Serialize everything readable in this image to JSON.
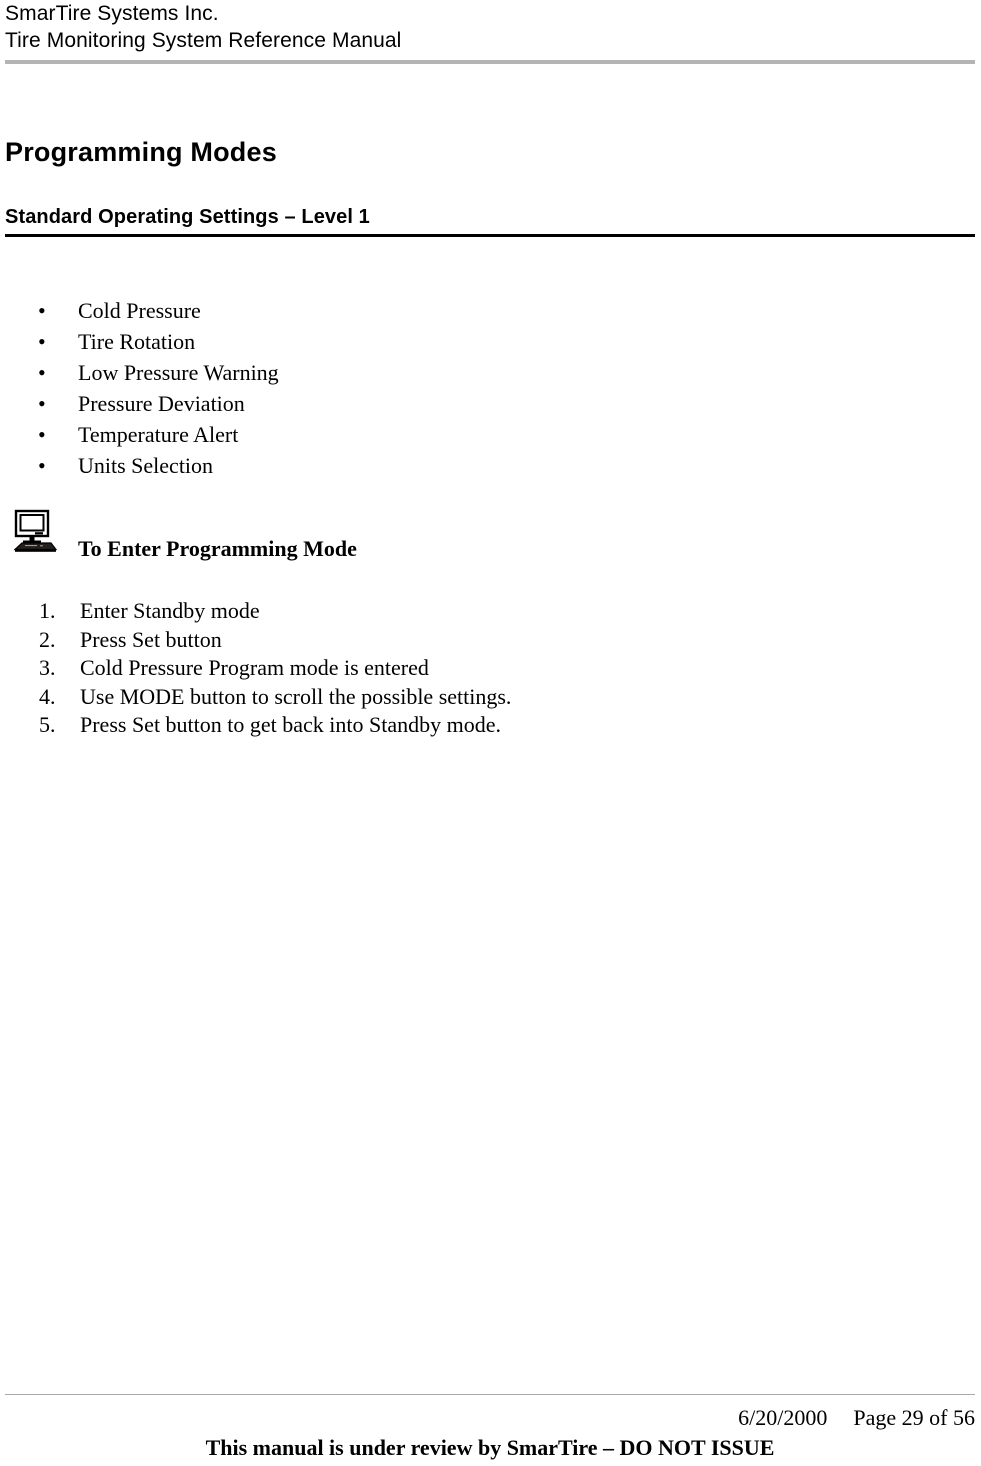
{
  "header": {
    "company": "SmarTire Systems Inc.",
    "manual_title": "Tire Monitoring System Reference Manual"
  },
  "headings": {
    "page_title": "Programming Modes",
    "section_title": "Standard Operating Settings – Level 1"
  },
  "settings_list": {
    "bullet": "•",
    "items": [
      "Cold Pressure",
      "Tire Rotation",
      "Low Pressure Warning",
      "Pressure Deviation",
      "Temperature Alert",
      "Units Selection"
    ]
  },
  "callout": {
    "icon": "computer-icon",
    "heading": "To Enter Programming Mode"
  },
  "steps": {
    "markers": [
      "1.",
      "2.",
      "3.",
      "4.",
      "5."
    ],
    "items": [
      "Enter Standby mode",
      "Press Set button",
      "Cold Pressure Program mode is entered",
      "Use MODE button to scroll the possible settings.",
      "Press Set button to get back into Standby mode."
    ]
  },
  "footer": {
    "date": "6/20/2000",
    "page": "Page 29 of 56",
    "notice": "This manual is under review by SmarTire – DO NOT ISSUE"
  },
  "colors": {
    "header_rule": "#b4b4b4",
    "section_rule": "#000000",
    "footer_rule": "#a9a9a9",
    "text": "#000000"
  }
}
